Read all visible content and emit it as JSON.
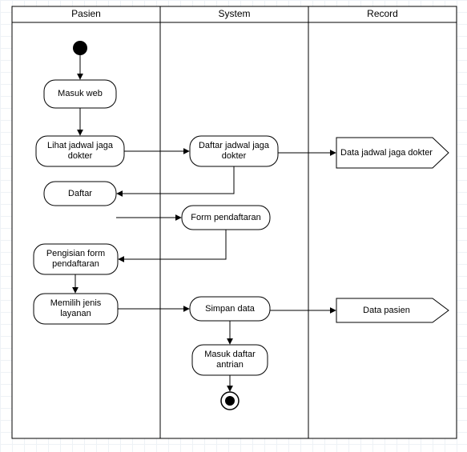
{
  "diagram_type": "UML Activity Diagram (with swimlanes)",
  "swimlanes": [
    {
      "id": "pasien",
      "title": "Pasien"
    },
    {
      "id": "system",
      "title": "System"
    },
    {
      "id": "record",
      "title": "Record"
    }
  ],
  "nodes": {
    "start": {
      "lane": "pasien",
      "kind": "initial"
    },
    "masuk_web": {
      "lane": "pasien",
      "kind": "activity",
      "text": "Masuk web"
    },
    "lihat_jadwal": {
      "lane": "pasien",
      "kind": "activity",
      "text": "Lihat jadwal jaga dokter"
    },
    "daftar_jadwal": {
      "lane": "system",
      "kind": "activity",
      "text": "Daftar jadwal jaga dokter"
    },
    "data_jadwal": {
      "lane": "record",
      "kind": "signal",
      "text": "Data jadwal jaga dokter"
    },
    "daftar": {
      "lane": "pasien",
      "kind": "activity",
      "text": "Daftar"
    },
    "form_pendaftaran": {
      "lane": "system",
      "kind": "activity",
      "text": "Form pendaftaran"
    },
    "pengisian_form": {
      "lane": "pasien",
      "kind": "activity",
      "text": "Pengisian form pendaftaran"
    },
    "memilih_layanan": {
      "lane": "pasien",
      "kind": "activity",
      "text": "Memilih jenis layanan"
    },
    "simpan_data": {
      "lane": "system",
      "kind": "activity",
      "text": "Simpan data"
    },
    "data_pasien": {
      "lane": "record",
      "kind": "signal",
      "text": "Data pasien"
    },
    "masuk_antrian": {
      "lane": "system",
      "kind": "activity",
      "text": "Masuk daftar antrian"
    },
    "end": {
      "lane": "system",
      "kind": "final"
    }
  },
  "edges": [
    [
      "start",
      "masuk_web"
    ],
    [
      "masuk_web",
      "lihat_jadwal"
    ],
    [
      "lihat_jadwal",
      "daftar_jadwal"
    ],
    [
      "daftar_jadwal",
      "data_jadwal"
    ],
    [
      "daftar_jadwal",
      "daftar"
    ],
    [
      "daftar",
      "form_pendaftaran"
    ],
    [
      "form_pendaftaran",
      "pengisian_form"
    ],
    [
      "pengisian_form",
      "memilih_layanan"
    ],
    [
      "memilih_layanan",
      "simpan_data"
    ],
    [
      "simpan_data",
      "data_pasien"
    ],
    [
      "simpan_data",
      "masuk_antrian"
    ],
    [
      "masuk_antrian",
      "end"
    ]
  ]
}
